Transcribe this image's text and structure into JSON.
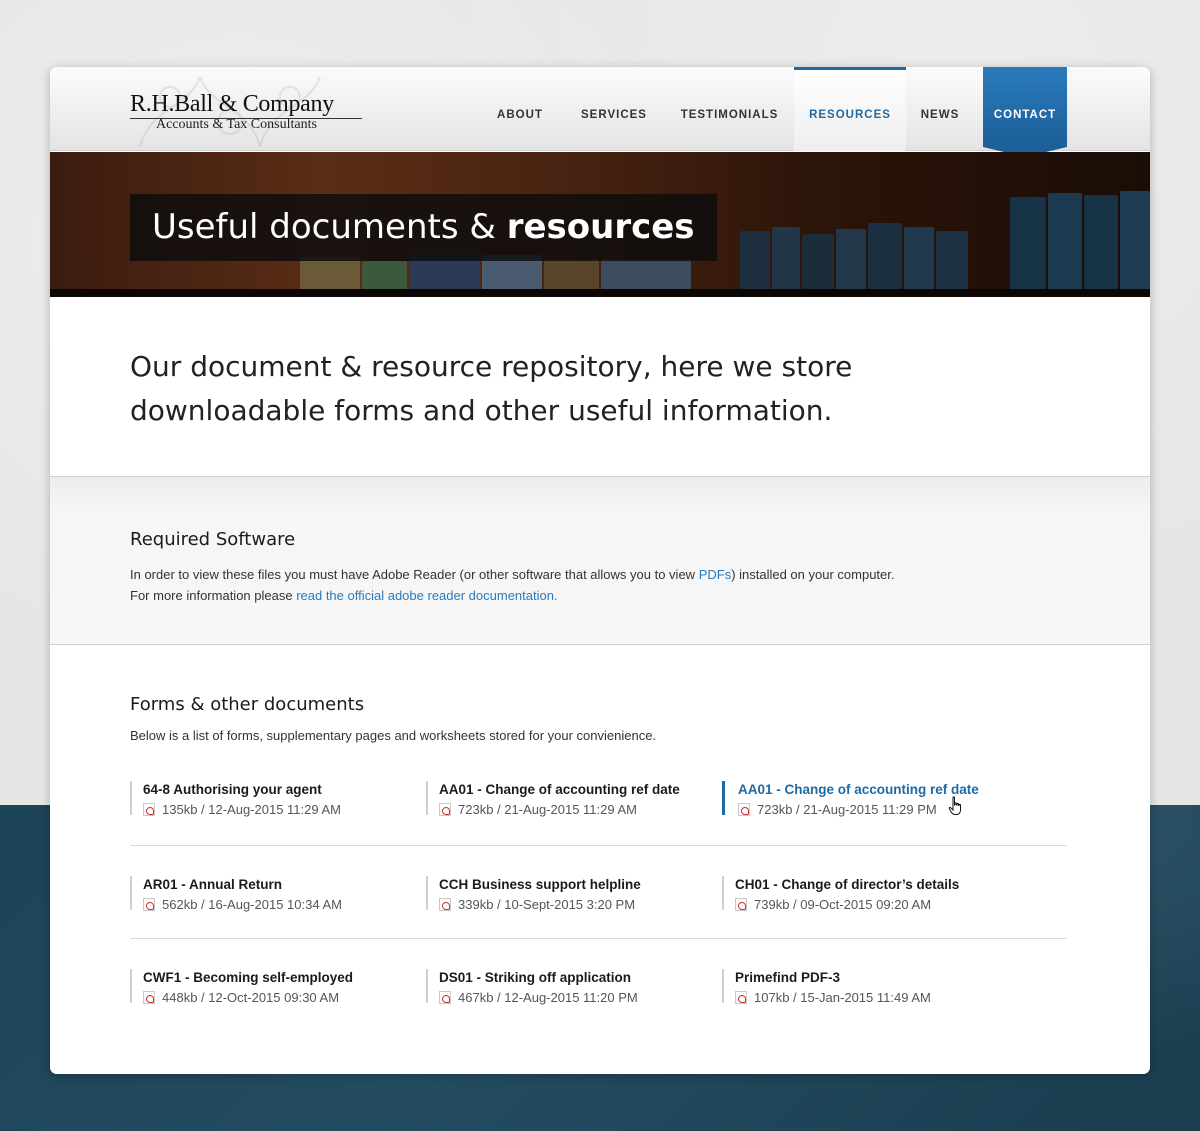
{
  "brand": {
    "title": "R.H.Ball & Company",
    "subtitle": "Accounts & Tax Consultants"
  },
  "nav": {
    "items": [
      {
        "label": "ABOUT",
        "active": false
      },
      {
        "label": "SERVICES",
        "active": false
      },
      {
        "label": "TESTIMONIALS",
        "active": false
      },
      {
        "label": "RESOURCES",
        "active": true
      },
      {
        "label": "NEWS",
        "active": false
      },
      {
        "label": "CONTACT",
        "active": false
      }
    ]
  },
  "hero": {
    "title_light": "Useful documents & ",
    "title_bold": "resources"
  },
  "intro": {
    "text": "Our document & resource repository, here we store downloadable forms and other useful information."
  },
  "software": {
    "heading": "Required Software",
    "line1_before": "In order to view these files you must have Adobe Reader (or other software that allows you to view ",
    "line1_link": "PDFs",
    "line1_after": ") installed on your computer.",
    "line2_before": "For more information please ",
    "line2_link": "read the official adobe reader documentation."
  },
  "forms": {
    "heading": "Forms & other documents",
    "description": "Below is a list of forms, supplementary pages and worksheets stored for your convienience.",
    "documents": [
      {
        "name": "64-8 Authorising your agent",
        "meta": "135kb / 12-Aug-2015 11:29 AM"
      },
      {
        "name": "AA01 - Change of accounting ref date",
        "meta": "723kb / 21-Aug-2015 11:29 AM"
      },
      {
        "name": "AA01 - Change of accounting ref date",
        "meta": "723kb / 21-Aug-2015 11:29 PM"
      },
      {
        "name": "AR01 - Annual Return",
        "meta": "562kb / 16-Aug-2015 10:34 AM"
      },
      {
        "name": "CCH Business support helpline",
        "meta": "339kb / 10-Sept-2015 3:20 PM"
      },
      {
        "name": "CH01 - Change of director’s details",
        "meta": "739kb / 09-Oct-2015 09:20 AM"
      },
      {
        "name": "CWF1 - Becoming self-employed",
        "meta": "448kb / 12-Oct-2015 09:30 AM"
      },
      {
        "name": "DS01 - Striking off application",
        "meta": "467kb / 12-Aug-2015 11:20 PM"
      },
      {
        "name": "Primefind PDF-3",
        "meta": "107kb / 15-Jan-2015 11:49 AM"
      }
    ]
  },
  "colors": {
    "accent": "#1e6aa4",
    "link": "#2a7bbd",
    "contact_bg": "#2a7bbd"
  },
  "icons": {
    "file": "pdf-icon",
    "cursor": "hand-pointer-icon"
  }
}
